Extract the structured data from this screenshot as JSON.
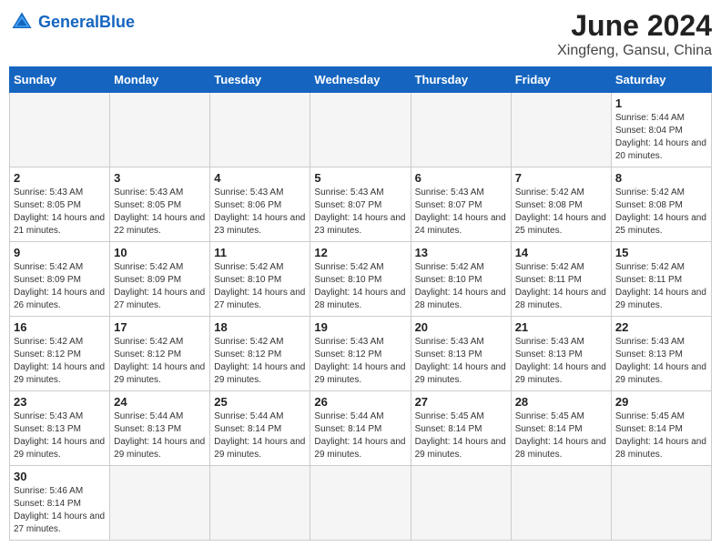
{
  "header": {
    "logo_general": "General",
    "logo_blue": "Blue",
    "month_title": "June 2024",
    "location": "Xingfeng, Gansu, China"
  },
  "weekdays": [
    "Sunday",
    "Monday",
    "Tuesday",
    "Wednesday",
    "Thursday",
    "Friday",
    "Saturday"
  ],
  "days": [
    {
      "day": "",
      "empty": true
    },
    {
      "day": "",
      "empty": true
    },
    {
      "day": "",
      "empty": true
    },
    {
      "day": "",
      "empty": true
    },
    {
      "day": "",
      "empty": true
    },
    {
      "day": "",
      "empty": true
    },
    {
      "day": "1",
      "sunrise": "Sunrise: 5:44 AM",
      "sunset": "Sunset: 8:04 PM",
      "daylight": "Daylight: 14 hours and 20 minutes."
    },
    {
      "day": "2",
      "sunrise": "Sunrise: 5:43 AM",
      "sunset": "Sunset: 8:05 PM",
      "daylight": "Daylight: 14 hours and 21 minutes."
    },
    {
      "day": "3",
      "sunrise": "Sunrise: 5:43 AM",
      "sunset": "Sunset: 8:05 PM",
      "daylight": "Daylight: 14 hours and 22 minutes."
    },
    {
      "day": "4",
      "sunrise": "Sunrise: 5:43 AM",
      "sunset": "Sunset: 8:06 PM",
      "daylight": "Daylight: 14 hours and 23 minutes."
    },
    {
      "day": "5",
      "sunrise": "Sunrise: 5:43 AM",
      "sunset": "Sunset: 8:07 PM",
      "daylight": "Daylight: 14 hours and 23 minutes."
    },
    {
      "day": "6",
      "sunrise": "Sunrise: 5:43 AM",
      "sunset": "Sunset: 8:07 PM",
      "daylight": "Daylight: 14 hours and 24 minutes."
    },
    {
      "day": "7",
      "sunrise": "Sunrise: 5:42 AM",
      "sunset": "Sunset: 8:08 PM",
      "daylight": "Daylight: 14 hours and 25 minutes."
    },
    {
      "day": "8",
      "sunrise": "Sunrise: 5:42 AM",
      "sunset": "Sunset: 8:08 PM",
      "daylight": "Daylight: 14 hours and 25 minutes."
    },
    {
      "day": "9",
      "sunrise": "Sunrise: 5:42 AM",
      "sunset": "Sunset: 8:09 PM",
      "daylight": "Daylight: 14 hours and 26 minutes."
    },
    {
      "day": "10",
      "sunrise": "Sunrise: 5:42 AM",
      "sunset": "Sunset: 8:09 PM",
      "daylight": "Daylight: 14 hours and 27 minutes."
    },
    {
      "day": "11",
      "sunrise": "Sunrise: 5:42 AM",
      "sunset": "Sunset: 8:10 PM",
      "daylight": "Daylight: 14 hours and 27 minutes."
    },
    {
      "day": "12",
      "sunrise": "Sunrise: 5:42 AM",
      "sunset": "Sunset: 8:10 PM",
      "daylight": "Daylight: 14 hours and 28 minutes."
    },
    {
      "day": "13",
      "sunrise": "Sunrise: 5:42 AM",
      "sunset": "Sunset: 8:10 PM",
      "daylight": "Daylight: 14 hours and 28 minutes."
    },
    {
      "day": "14",
      "sunrise": "Sunrise: 5:42 AM",
      "sunset": "Sunset: 8:11 PM",
      "daylight": "Daylight: 14 hours and 28 minutes."
    },
    {
      "day": "15",
      "sunrise": "Sunrise: 5:42 AM",
      "sunset": "Sunset: 8:11 PM",
      "daylight": "Daylight: 14 hours and 29 minutes."
    },
    {
      "day": "16",
      "sunrise": "Sunrise: 5:42 AM",
      "sunset": "Sunset: 8:12 PM",
      "daylight": "Daylight: 14 hours and 29 minutes."
    },
    {
      "day": "17",
      "sunrise": "Sunrise: 5:42 AM",
      "sunset": "Sunset: 8:12 PM",
      "daylight": "Daylight: 14 hours and 29 minutes."
    },
    {
      "day": "18",
      "sunrise": "Sunrise: 5:42 AM",
      "sunset": "Sunset: 8:12 PM",
      "daylight": "Daylight: 14 hours and 29 minutes."
    },
    {
      "day": "19",
      "sunrise": "Sunrise: 5:43 AM",
      "sunset": "Sunset: 8:12 PM",
      "daylight": "Daylight: 14 hours and 29 minutes."
    },
    {
      "day": "20",
      "sunrise": "Sunrise: 5:43 AM",
      "sunset": "Sunset: 8:13 PM",
      "daylight": "Daylight: 14 hours and 29 minutes."
    },
    {
      "day": "21",
      "sunrise": "Sunrise: 5:43 AM",
      "sunset": "Sunset: 8:13 PM",
      "daylight": "Daylight: 14 hours and 29 minutes."
    },
    {
      "day": "22",
      "sunrise": "Sunrise: 5:43 AM",
      "sunset": "Sunset: 8:13 PM",
      "daylight": "Daylight: 14 hours and 29 minutes."
    },
    {
      "day": "23",
      "sunrise": "Sunrise: 5:43 AM",
      "sunset": "Sunset: 8:13 PM",
      "daylight": "Daylight: 14 hours and 29 minutes."
    },
    {
      "day": "24",
      "sunrise": "Sunrise: 5:44 AM",
      "sunset": "Sunset: 8:13 PM",
      "daylight": "Daylight: 14 hours and 29 minutes."
    },
    {
      "day": "25",
      "sunrise": "Sunrise: 5:44 AM",
      "sunset": "Sunset: 8:14 PM",
      "daylight": "Daylight: 14 hours and 29 minutes."
    },
    {
      "day": "26",
      "sunrise": "Sunrise: 5:44 AM",
      "sunset": "Sunset: 8:14 PM",
      "daylight": "Daylight: 14 hours and 29 minutes."
    },
    {
      "day": "27",
      "sunrise": "Sunrise: 5:45 AM",
      "sunset": "Sunset: 8:14 PM",
      "daylight": "Daylight: 14 hours and 29 minutes."
    },
    {
      "day": "28",
      "sunrise": "Sunrise: 5:45 AM",
      "sunset": "Sunset: 8:14 PM",
      "daylight": "Daylight: 14 hours and 28 minutes."
    },
    {
      "day": "29",
      "sunrise": "Sunrise: 5:45 AM",
      "sunset": "Sunset: 8:14 PM",
      "daylight": "Daylight: 14 hours and 28 minutes."
    },
    {
      "day": "30",
      "sunrise": "Sunrise: 5:46 AM",
      "sunset": "Sunset: 8:14 PM",
      "daylight": "Daylight: 14 hours and 27 minutes."
    },
    {
      "day": "",
      "empty": true
    },
    {
      "day": "",
      "empty": true
    },
    {
      "day": "",
      "empty": true
    },
    {
      "day": "",
      "empty": true
    },
    {
      "day": "",
      "empty": true
    },
    {
      "day": "",
      "empty": true
    }
  ]
}
